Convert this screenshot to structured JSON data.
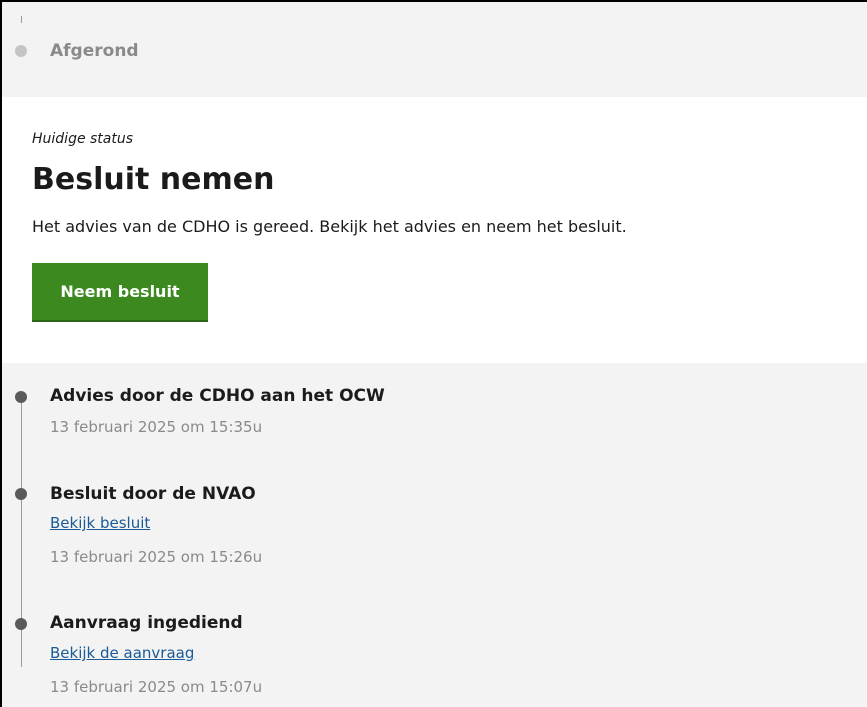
{
  "top_step": {
    "label": "Afgerond"
  },
  "current_status": {
    "eyebrow": "Huidige status",
    "title": "Besluit nemen",
    "description": "Het advies van de CDHO is gereed. Bekijk het advies en neem het besluit.",
    "button_label": "Neem besluit"
  },
  "timeline": {
    "items": [
      {
        "title": "Advies door de CDHO aan het OCW",
        "link": null,
        "date": "13 februari 2025 om 15:35u"
      },
      {
        "title": "Besluit door de NVAO",
        "link": "Bekijk besluit",
        "date": "13 februari 2025 om 15:26u"
      },
      {
        "title": "Aanvraag ingediend",
        "link": "Bekijk de aanvraag",
        "date": "13 februari 2025 om 15:07u"
      }
    ]
  },
  "colors": {
    "primary_button": "#3c8a1f",
    "link": "#1a5a96",
    "muted_text": "#8a8a8a",
    "panel_background": "#f3f3f3"
  }
}
